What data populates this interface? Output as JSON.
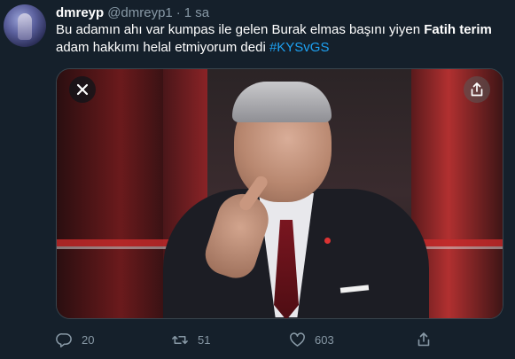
{
  "author": {
    "display_name": "dmreyp",
    "handle": "@dmreyp1",
    "separator": "·",
    "time": "1 sa"
  },
  "tweet": {
    "text_part1": "Bu adamın ahı var kumpas ile gelen Burak elmas başını yiyen ",
    "bold_name": "Fatih terim",
    "text_part2": " adam hakkımı helal etmiyorum dedi ",
    "hashtag": "#KYSvGS"
  },
  "media": {
    "close_icon": "close-icon",
    "share_icon": "share-icon"
  },
  "actions": {
    "reply_count": "20",
    "retweet_count": "51",
    "like_count": "603"
  },
  "colors": {
    "background": "#15202b",
    "secondary_text": "#8899a6",
    "hashtag": "#1da1f2",
    "border": "#38444d"
  }
}
